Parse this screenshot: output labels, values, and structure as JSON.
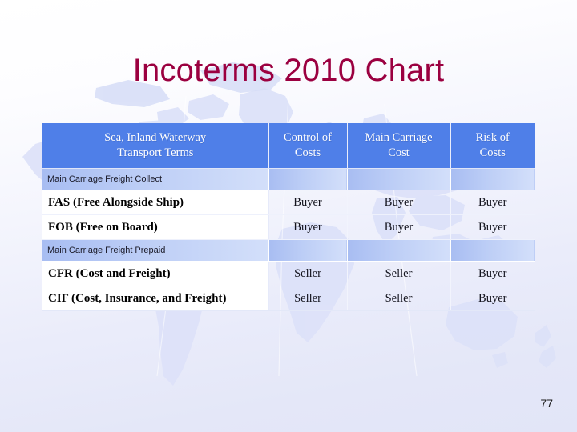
{
  "slide": {
    "title": "Incoterms 2010 Chart",
    "page_number": "77",
    "title_color": "#9b0040",
    "header_color": "#4f7fe8",
    "band_color": "#a8bdf2"
  },
  "table": {
    "headers": [
      "Sea, Inland Waterway Transport Terms",
      "Control of Costs",
      "Main Carriage Cost",
      "Risk of Costs"
    ],
    "header_lines": {
      "col1_line1": "Sea, Inland Waterway",
      "col1_line2": "Transport Terms",
      "col2_line1": "Control of",
      "col2_line2": "Costs",
      "col3_line1": "Main Carriage",
      "col3_line2": "Cost",
      "col4_line1": "Risk of",
      "col4_line2": "Costs"
    },
    "sections": [
      {
        "band_label": "Main Carriage Freight Collect",
        "rows": [
          {
            "term": "FAS (Free Alongside Ship)",
            "control_of_costs": "Buyer",
            "main_carriage_cost": "Buyer",
            "risk_of_costs": "Buyer"
          },
          {
            "term": "FOB (Free on Board)",
            "control_of_costs": "Buyer",
            "main_carriage_cost": "Buyer",
            "risk_of_costs": "Buyer"
          }
        ]
      },
      {
        "band_label": "Main Carriage Freight Prepaid",
        "rows": [
          {
            "term": "CFR (Cost and Freight)",
            "control_of_costs": "Seller",
            "main_carriage_cost": "Seller",
            "risk_of_costs": "Buyer"
          },
          {
            "term": "CIF (Cost, Insurance, and Freight)",
            "control_of_costs": "Seller",
            "main_carriage_cost": "Seller",
            "risk_of_costs": "Buyer"
          }
        ]
      }
    ]
  }
}
